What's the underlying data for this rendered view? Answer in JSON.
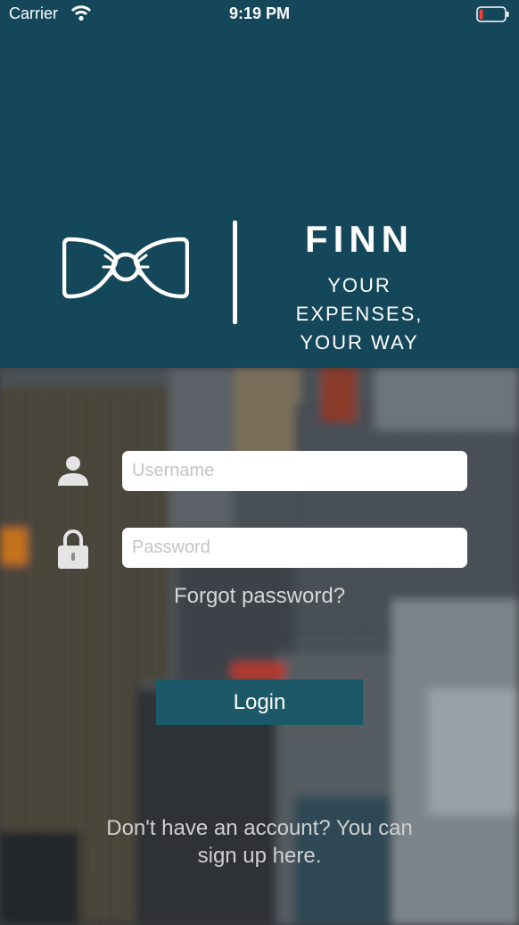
{
  "status_bar": {
    "carrier": "Carrier",
    "time": "9:19 PM",
    "wifi_icon": "wifi-icon",
    "battery_icon": "battery-low-icon"
  },
  "brand": {
    "logo_icon": "bow-tie-icon",
    "name": "FINN",
    "tagline_line1": "YOUR EXPENSES,",
    "tagline_line2": "YOUR WAY"
  },
  "login_form": {
    "username": {
      "icon": "user-icon",
      "placeholder": "Username",
      "value": ""
    },
    "password": {
      "icon": "lock-icon",
      "placeholder": "Password",
      "value": ""
    },
    "forgot_password": "Forgot password?",
    "login_label": "Login",
    "signup_line1": "Don't have an account? You can",
    "signup_line2": "sign up here."
  },
  "colors": {
    "header_background": "#14475a",
    "button_background": "#1b5868",
    "text_light": "#ffffff"
  }
}
